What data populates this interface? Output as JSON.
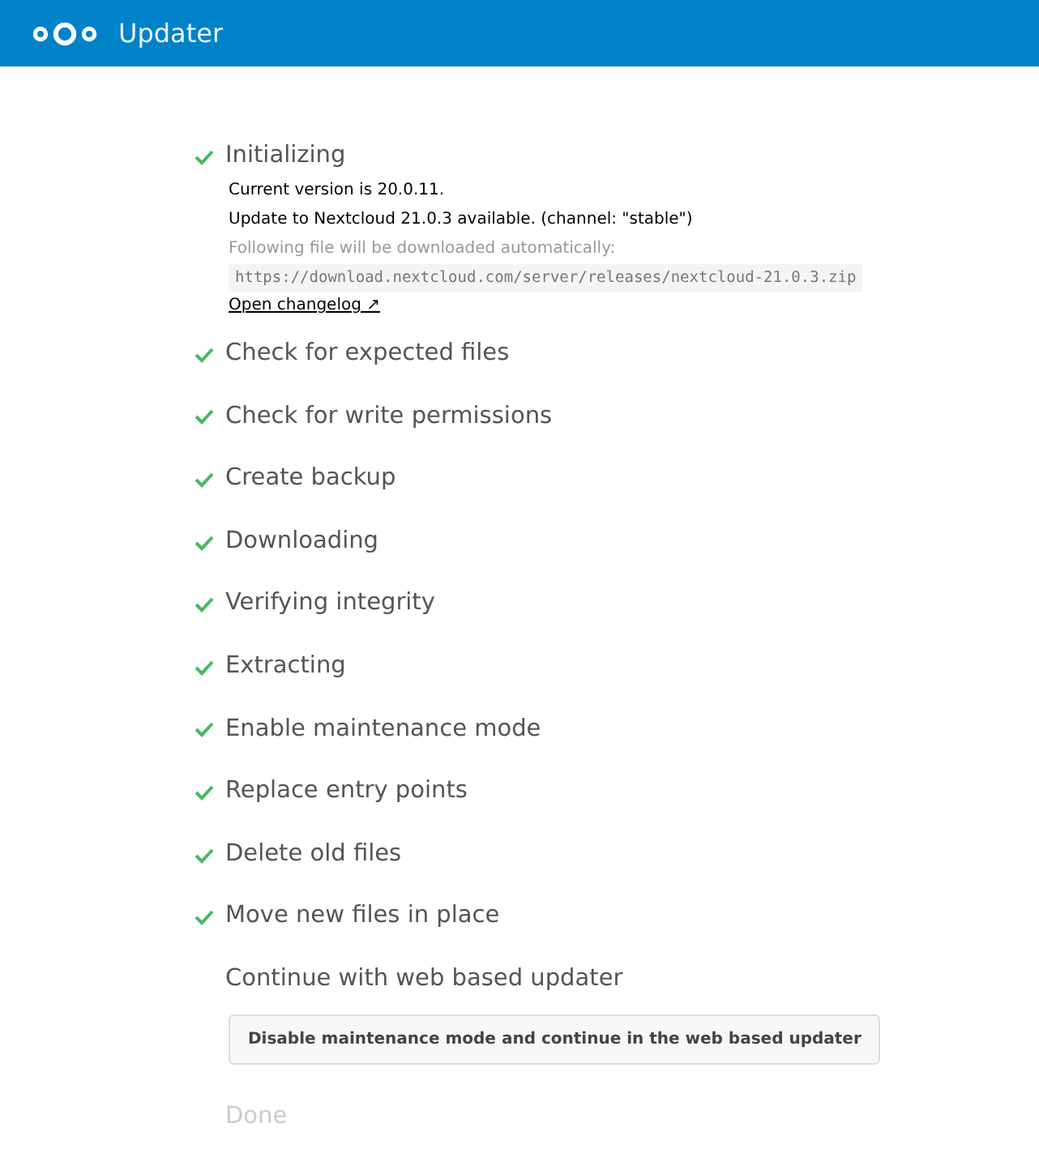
{
  "header": {
    "title": "Updater"
  },
  "steps": [
    {
      "title": "Initializing",
      "checked": true,
      "disabled": false,
      "details": {
        "lines": [
          "Current version is 20.0.11.",
          "Update to Nextcloud 21.0.3 available. (channel: \"stable\")"
        ],
        "note": "Following file will be downloaded automatically:",
        "url": "https://download.nextcloud.com/server/releases/nextcloud-21.0.3.zip",
        "link": "Open changelog ↗"
      }
    },
    {
      "title": "Check for expected files",
      "checked": true,
      "disabled": false
    },
    {
      "title": "Check for write permissions",
      "checked": true,
      "disabled": false
    },
    {
      "title": "Create backup",
      "checked": true,
      "disabled": false
    },
    {
      "title": "Downloading",
      "checked": true,
      "disabled": false
    },
    {
      "title": "Verifying integrity",
      "checked": true,
      "disabled": false
    },
    {
      "title": "Extracting",
      "checked": true,
      "disabled": false
    },
    {
      "title": "Enable maintenance mode",
      "checked": true,
      "disabled": false
    },
    {
      "title": "Replace entry points",
      "checked": true,
      "disabled": false
    },
    {
      "title": "Delete old files",
      "checked": true,
      "disabled": false
    },
    {
      "title": "Move new files in place",
      "checked": true,
      "disabled": false
    },
    {
      "title": "Continue with web based updater",
      "checked": false,
      "disabled": false,
      "button": "Disable maintenance mode and continue in the web based updater"
    },
    {
      "title": "Done",
      "checked": false,
      "disabled": true
    }
  ]
}
